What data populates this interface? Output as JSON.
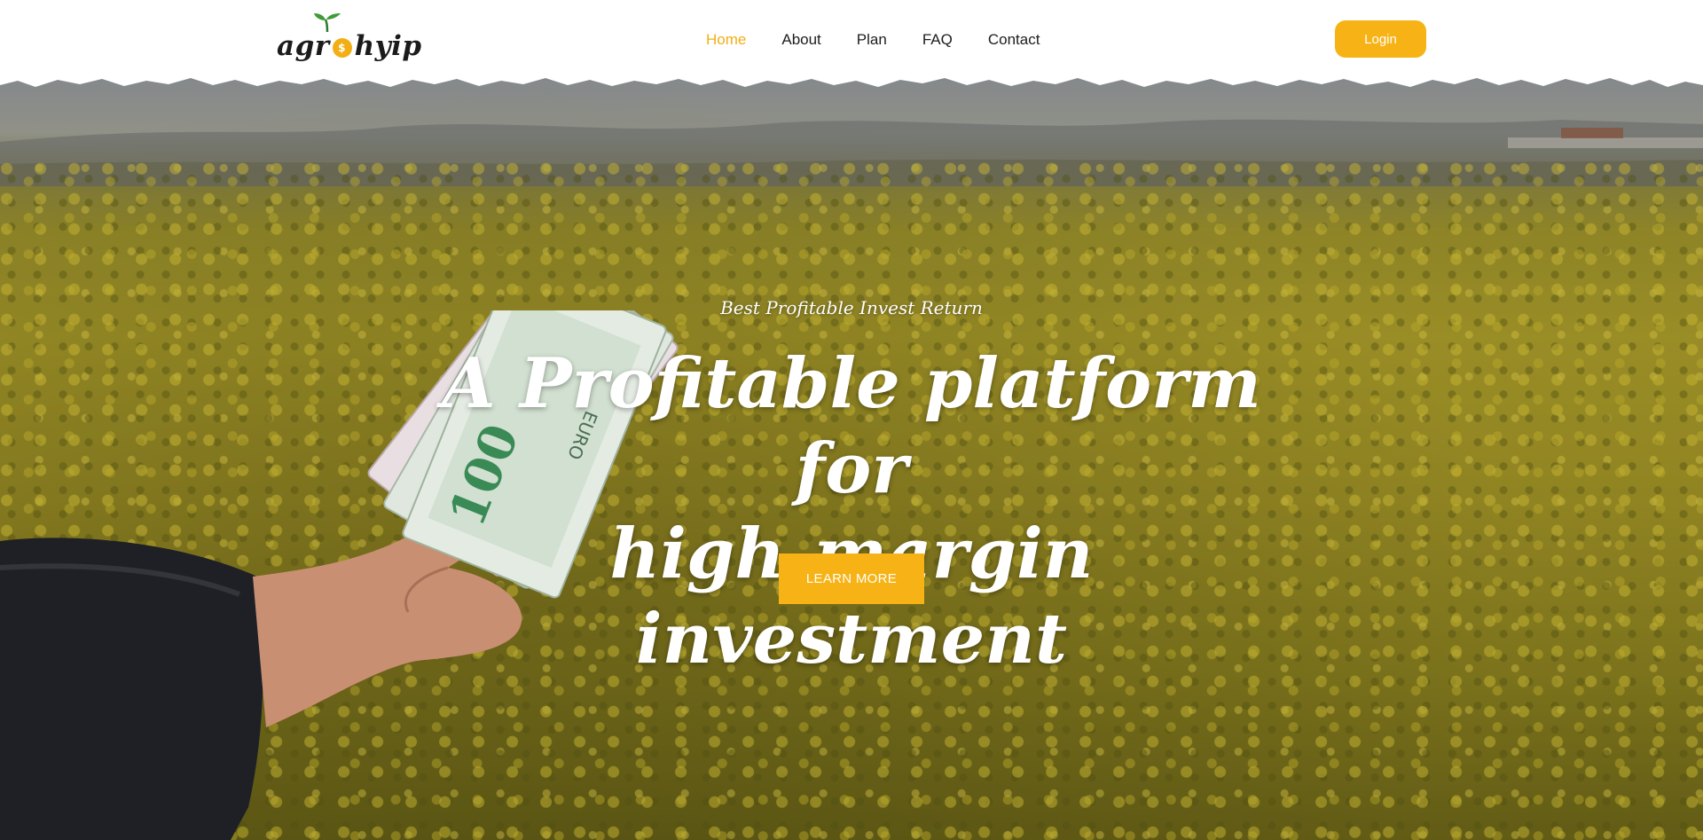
{
  "brand": {
    "logo_left": "agr",
    "logo_right": "hyip",
    "accent_color": "#f7b316"
  },
  "nav": {
    "items": [
      {
        "label": "Home",
        "active": true
      },
      {
        "label": "About",
        "active": false
      },
      {
        "label": "Plan",
        "active": false
      },
      {
        "label": "FAQ",
        "active": false
      },
      {
        "label": "Contact",
        "active": false
      }
    ]
  },
  "header": {
    "login_label": "Login"
  },
  "hero": {
    "tagline": "Best Profitable Invest Return",
    "headline_line1": "A Profitable platform for",
    "headline_line2": "high-margin investment",
    "cta_label": "LEARN MORE",
    "image_subject": "hand-holding-euro-banknotes-in-rapeseed-field",
    "banknote_denomination": "100",
    "banknote_currency": "EURO"
  },
  "icons": {
    "logo_coin": "dollar-coin-icon",
    "logo_sprout": "sprout-icon"
  }
}
